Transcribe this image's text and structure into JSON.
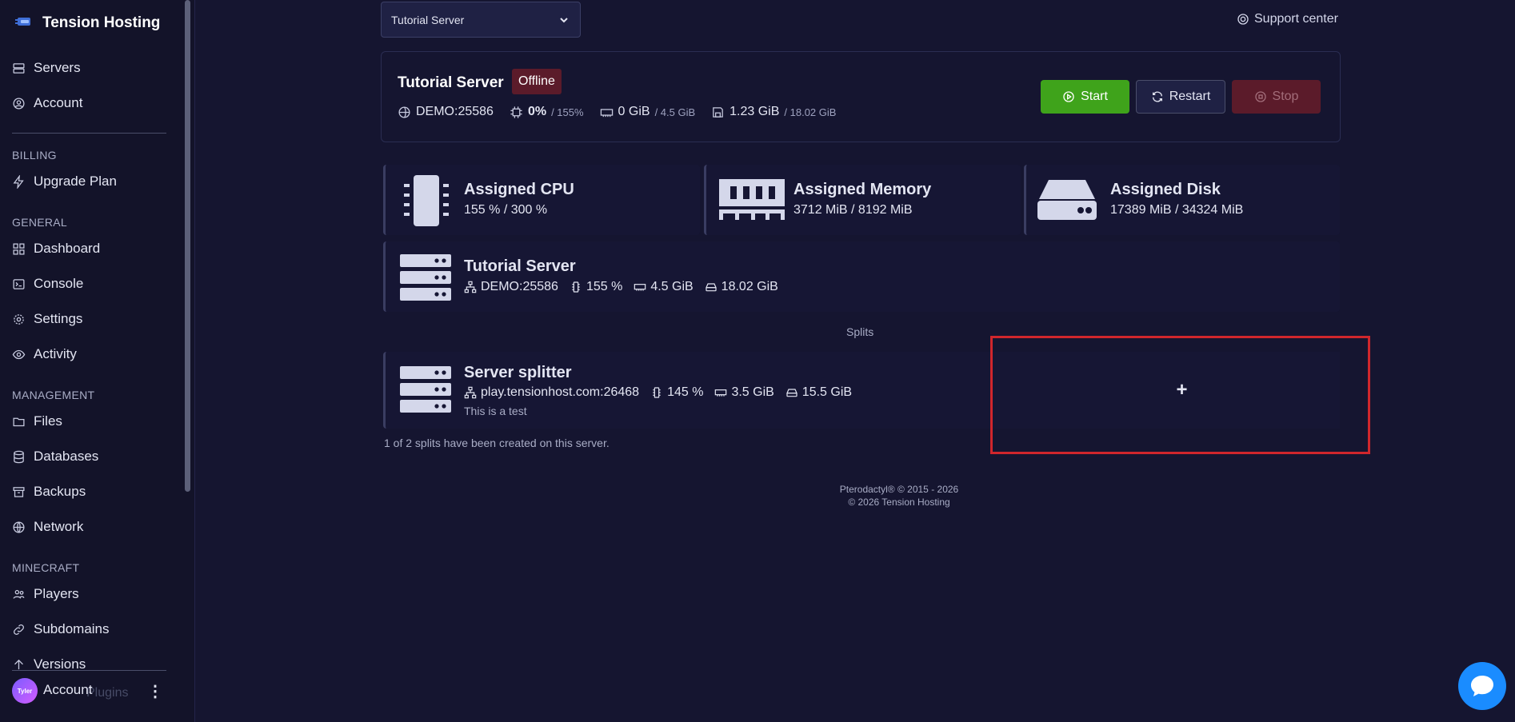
{
  "brand": {
    "name": "Tension Hosting"
  },
  "nav": {
    "servers": "Servers",
    "account": "Account",
    "billing_section": "BILLING",
    "upgrade_plan": "Upgrade Plan",
    "general_section": "GENERAL",
    "dashboard": "Dashboard",
    "console": "Console",
    "settings": "Settings",
    "activity": "Activity",
    "management_section": "MANAGEMENT",
    "files": "Files",
    "databases": "Databases",
    "backups": "Backups",
    "network": "Network",
    "minecraft_section": "MINECRAFT",
    "players": "Players",
    "subdomains": "Subdomains",
    "versions": "Versions",
    "plugins": "Plugins"
  },
  "user": {
    "avatar_text": "Tyler",
    "account_label": "Account"
  },
  "header": {
    "server_select": "Tutorial Server",
    "support": "Support center"
  },
  "status": {
    "name": "Tutorial Server",
    "badge": "Offline",
    "address": "DEMO:25586",
    "cpu": "0%",
    "cpu_limit": "/ 155%",
    "memory": "0 GiB",
    "memory_limit": "/ 4.5 GiB",
    "disk": "1.23 GiB",
    "disk_limit": "/ 18.02 GiB",
    "start": "Start",
    "restart": "Restart",
    "stop": "Stop"
  },
  "resources": {
    "cpu_title": "Assigned CPU",
    "cpu_value": "155 % / 300 %",
    "memory_title": "Assigned Memory",
    "memory_value": "3712 MiB / 8192 MiB",
    "disk_title": "Assigned Disk",
    "disk_value": "17389 MiB / 34324 MiB"
  },
  "main_server": {
    "name": "Tutorial Server",
    "address": "DEMO:25586",
    "cpu": "155 %",
    "memory": "4.5 GiB",
    "disk": "18.02 GiB"
  },
  "splits": {
    "label": "Splits",
    "item_name": "Server splitter",
    "item_address": "play.tensionhost.com:26468",
    "item_cpu": "145 %",
    "item_memory": "3.5 GiB",
    "item_disk": "15.5 GiB",
    "item_description": "This is a test",
    "add_label": "+",
    "note": "1 of 2 splits have been created on this server."
  },
  "footer": {
    "line1": "Pterodactyl® © 2015 - 2026",
    "line2": "© 2026 Tension Hosting"
  },
  "colors": {
    "background": "#151530",
    "start_green": "#3fa31b",
    "offline_red": "#5b1b2a",
    "highlight_red": "#d0262c",
    "chat_blue": "#1a8cff"
  }
}
